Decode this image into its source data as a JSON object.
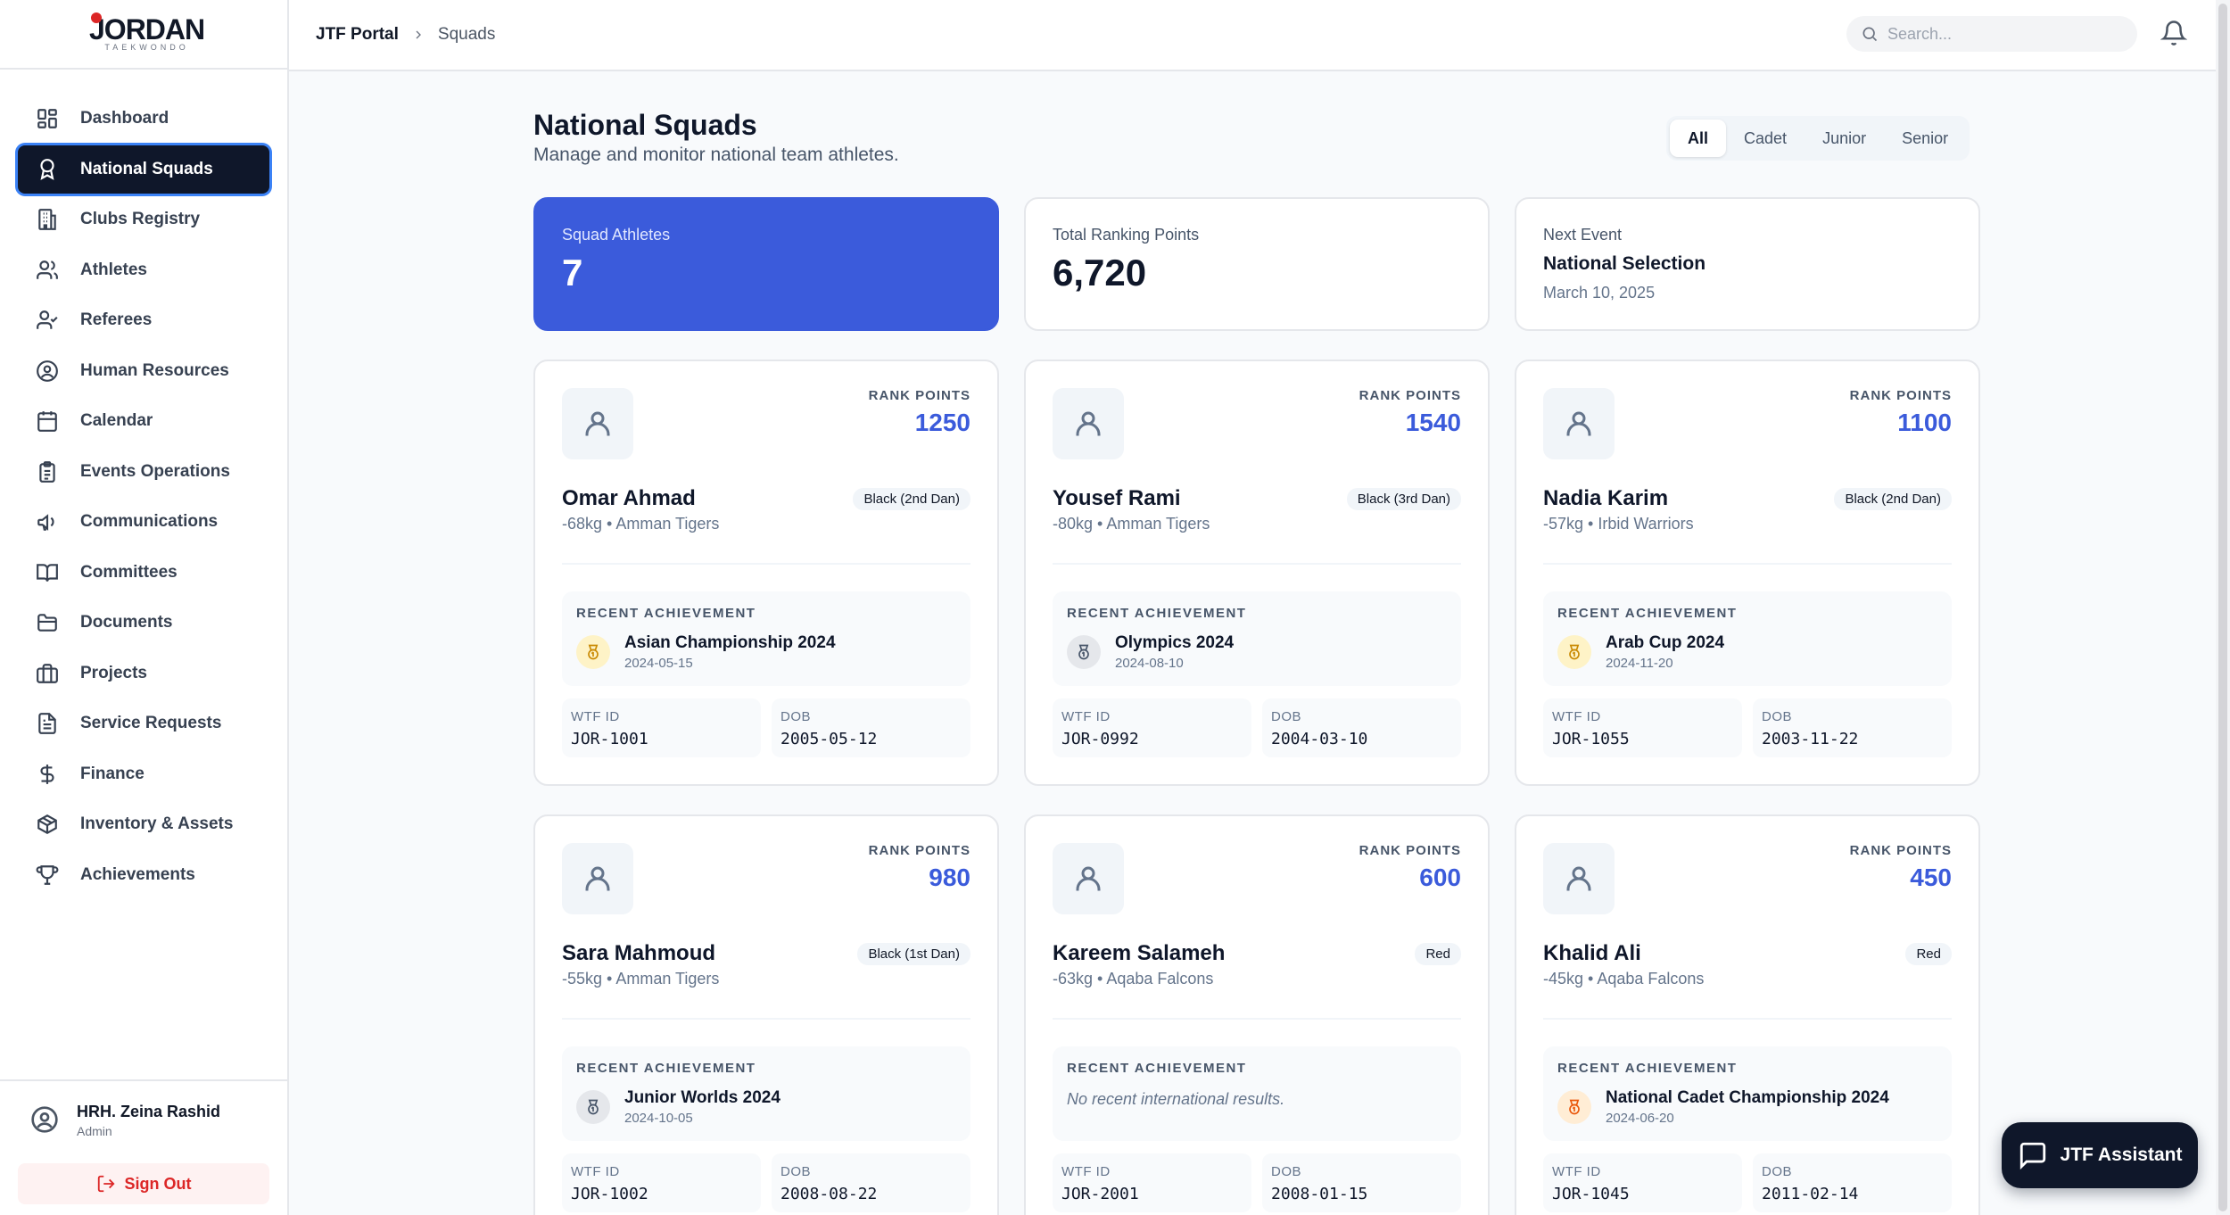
{
  "brand": {
    "title": "JORDAN",
    "subtitle": "TAEKWONDO"
  },
  "sidebar": {
    "items": [
      {
        "label": "Dashboard",
        "icon": "dashboard-icon"
      },
      {
        "label": "National Squads",
        "icon": "medal-ribbon-icon"
      },
      {
        "label": "Clubs Registry",
        "icon": "building-icon"
      },
      {
        "label": "Athletes",
        "icon": "users-icon"
      },
      {
        "label": "Referees",
        "icon": "user-check-icon"
      },
      {
        "label": "Human Resources",
        "icon": "user-circle-icon"
      },
      {
        "label": "Calendar",
        "icon": "calendar-icon"
      },
      {
        "label": "Events Operations",
        "icon": "clipboard-icon"
      },
      {
        "label": "Communications",
        "icon": "megaphone-icon"
      },
      {
        "label": "Committees",
        "icon": "book-open-icon"
      },
      {
        "label": "Documents",
        "icon": "folder-icon"
      },
      {
        "label": "Projects",
        "icon": "briefcase-icon"
      },
      {
        "label": "Service Requests",
        "icon": "file-text-icon"
      },
      {
        "label": "Finance",
        "icon": "dollar-icon"
      },
      {
        "label": "Inventory & Assets",
        "icon": "package-icon"
      },
      {
        "label": "Achievements",
        "icon": "trophy-icon"
      }
    ],
    "active_index": 1,
    "user": {
      "name": "HRH. Zeina Rashid",
      "role": "Admin"
    },
    "signout_label": "Sign Out"
  },
  "topbar": {
    "breadcrumb_root": "JTF Portal",
    "breadcrumb_current": "Squads",
    "search_placeholder": "Search..."
  },
  "page": {
    "title": "National Squads",
    "subtitle": "Manage and monitor national team athletes.",
    "filters": [
      "All",
      "Cadet",
      "Junior",
      "Senior"
    ],
    "active_filter": "All"
  },
  "stats": {
    "squad_label": "Squad Athletes",
    "squad_value": "7",
    "points_label": "Total Ranking Points",
    "points_value": "6,720",
    "event_label": "Next Event",
    "event_name": "National Selection",
    "event_date": "March 10, 2025"
  },
  "card_labels": {
    "rank_points": "RANK POINTS",
    "recent_achievement": "RECENT ACHIEVEMENT",
    "wtf_id": "WTF ID",
    "dob": "DOB"
  },
  "athletes": [
    {
      "name": "Omar Ahmad",
      "belt": "Black (2nd Dan)",
      "meta": "-68kg • Amman Tigers",
      "points": "1250",
      "achievement": "Asian Championship 2024",
      "achievement_date": "2024-05-15",
      "medal": "gold",
      "wtf_id": "JOR-1001",
      "dob": "2005-05-12"
    },
    {
      "name": "Yousef Rami",
      "belt": "Black (3rd Dan)",
      "meta": "-80kg • Amman Tigers",
      "points": "1540",
      "achievement": "Olympics 2024",
      "achievement_date": "2024-08-10",
      "medal": "silver",
      "wtf_id": "JOR-0992",
      "dob": "2004-03-10"
    },
    {
      "name": "Nadia Karim",
      "belt": "Black (2nd Dan)",
      "meta": "-57kg • Irbid Warriors",
      "points": "1100",
      "achievement": "Arab Cup 2024",
      "achievement_date": "2024-11-20",
      "medal": "gold",
      "wtf_id": "JOR-1055",
      "dob": "2003-11-22"
    },
    {
      "name": "Sara Mahmoud",
      "belt": "Black (1st Dan)",
      "meta": "-55kg • Amman Tigers",
      "points": "980",
      "achievement": "Junior Worlds 2024",
      "achievement_date": "2024-10-05",
      "medal": "silver",
      "wtf_id": "JOR-1002",
      "dob": "2008-08-22"
    },
    {
      "name": "Kareem Salameh",
      "belt": "Red",
      "meta": "-63kg • Aqaba Falcons",
      "points": "600",
      "achievement": "",
      "achievement_date": "",
      "no_achievement": "No recent international results.",
      "medal": "none",
      "wtf_id": "JOR-2001",
      "dob": "2008-01-15"
    },
    {
      "name": "Khalid Ali",
      "belt": "Red",
      "meta": "-45kg • Aqaba Falcons",
      "points": "450",
      "achievement": "National Cadet Championship 2024",
      "achievement_date": "2024-06-20",
      "medal": "bronze",
      "wtf_id": "JOR-1045",
      "dob": "2011-02-14"
    }
  ],
  "colors": {
    "accent": "#3b5bdb",
    "gold": "#fef3c7",
    "silver": "#e5e7eb",
    "bronze": "#ffedd5",
    "danger": "#dc2626"
  },
  "assistant_label": "JTF Assistant"
}
